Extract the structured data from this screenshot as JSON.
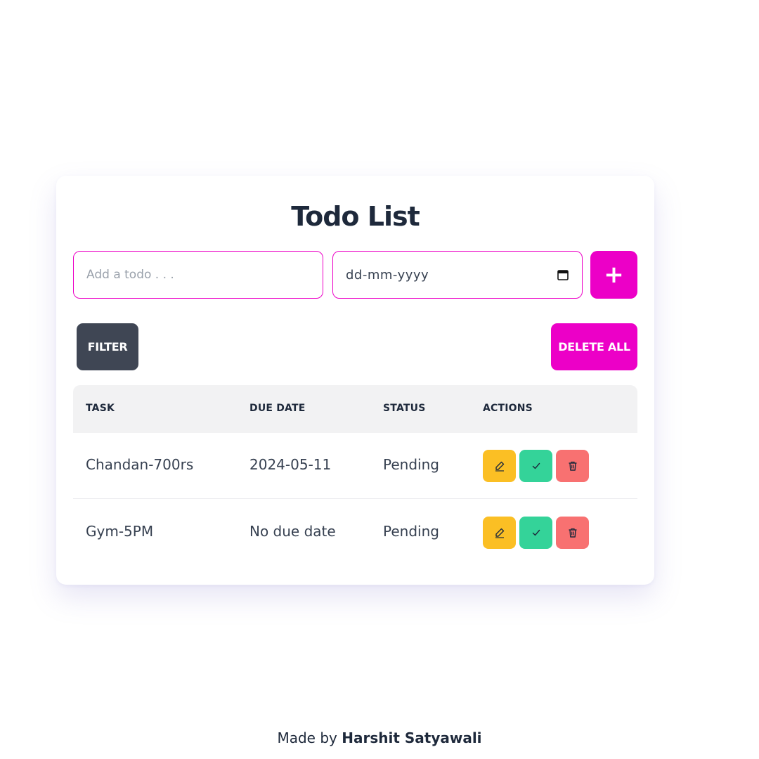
{
  "app": {
    "title": "Todo List"
  },
  "form": {
    "todo_placeholder": "Add a todo . . .",
    "todo_value": "",
    "date_placeholder": "dd-mm-yyyy",
    "add_label": "+"
  },
  "toolbar": {
    "filter_label": "FILTER",
    "delete_all_label": "DELETE ALL"
  },
  "table": {
    "headers": {
      "task": "TASK",
      "due_date": "DUE DATE",
      "status": "STATUS",
      "actions": "ACTIONS"
    },
    "rows": [
      {
        "task": "Chandan-700rs",
        "due_date": "2024-05-11",
        "status": "Pending"
      },
      {
        "task": "Gym-5PM",
        "due_date": "No due date",
        "status": "Pending"
      }
    ]
  },
  "footer": {
    "prefix": "Made by ",
    "author": "Harshit Satyawali"
  },
  "colors": {
    "accent": "#ec00c7",
    "filter": "#3f4654",
    "edit": "#fbbf24",
    "complete": "#34d399",
    "delete": "#f87171"
  },
  "icons": {
    "edit": "pencil-icon",
    "complete": "check-icon",
    "delete": "trash-icon",
    "calendar": "calendar-icon"
  }
}
